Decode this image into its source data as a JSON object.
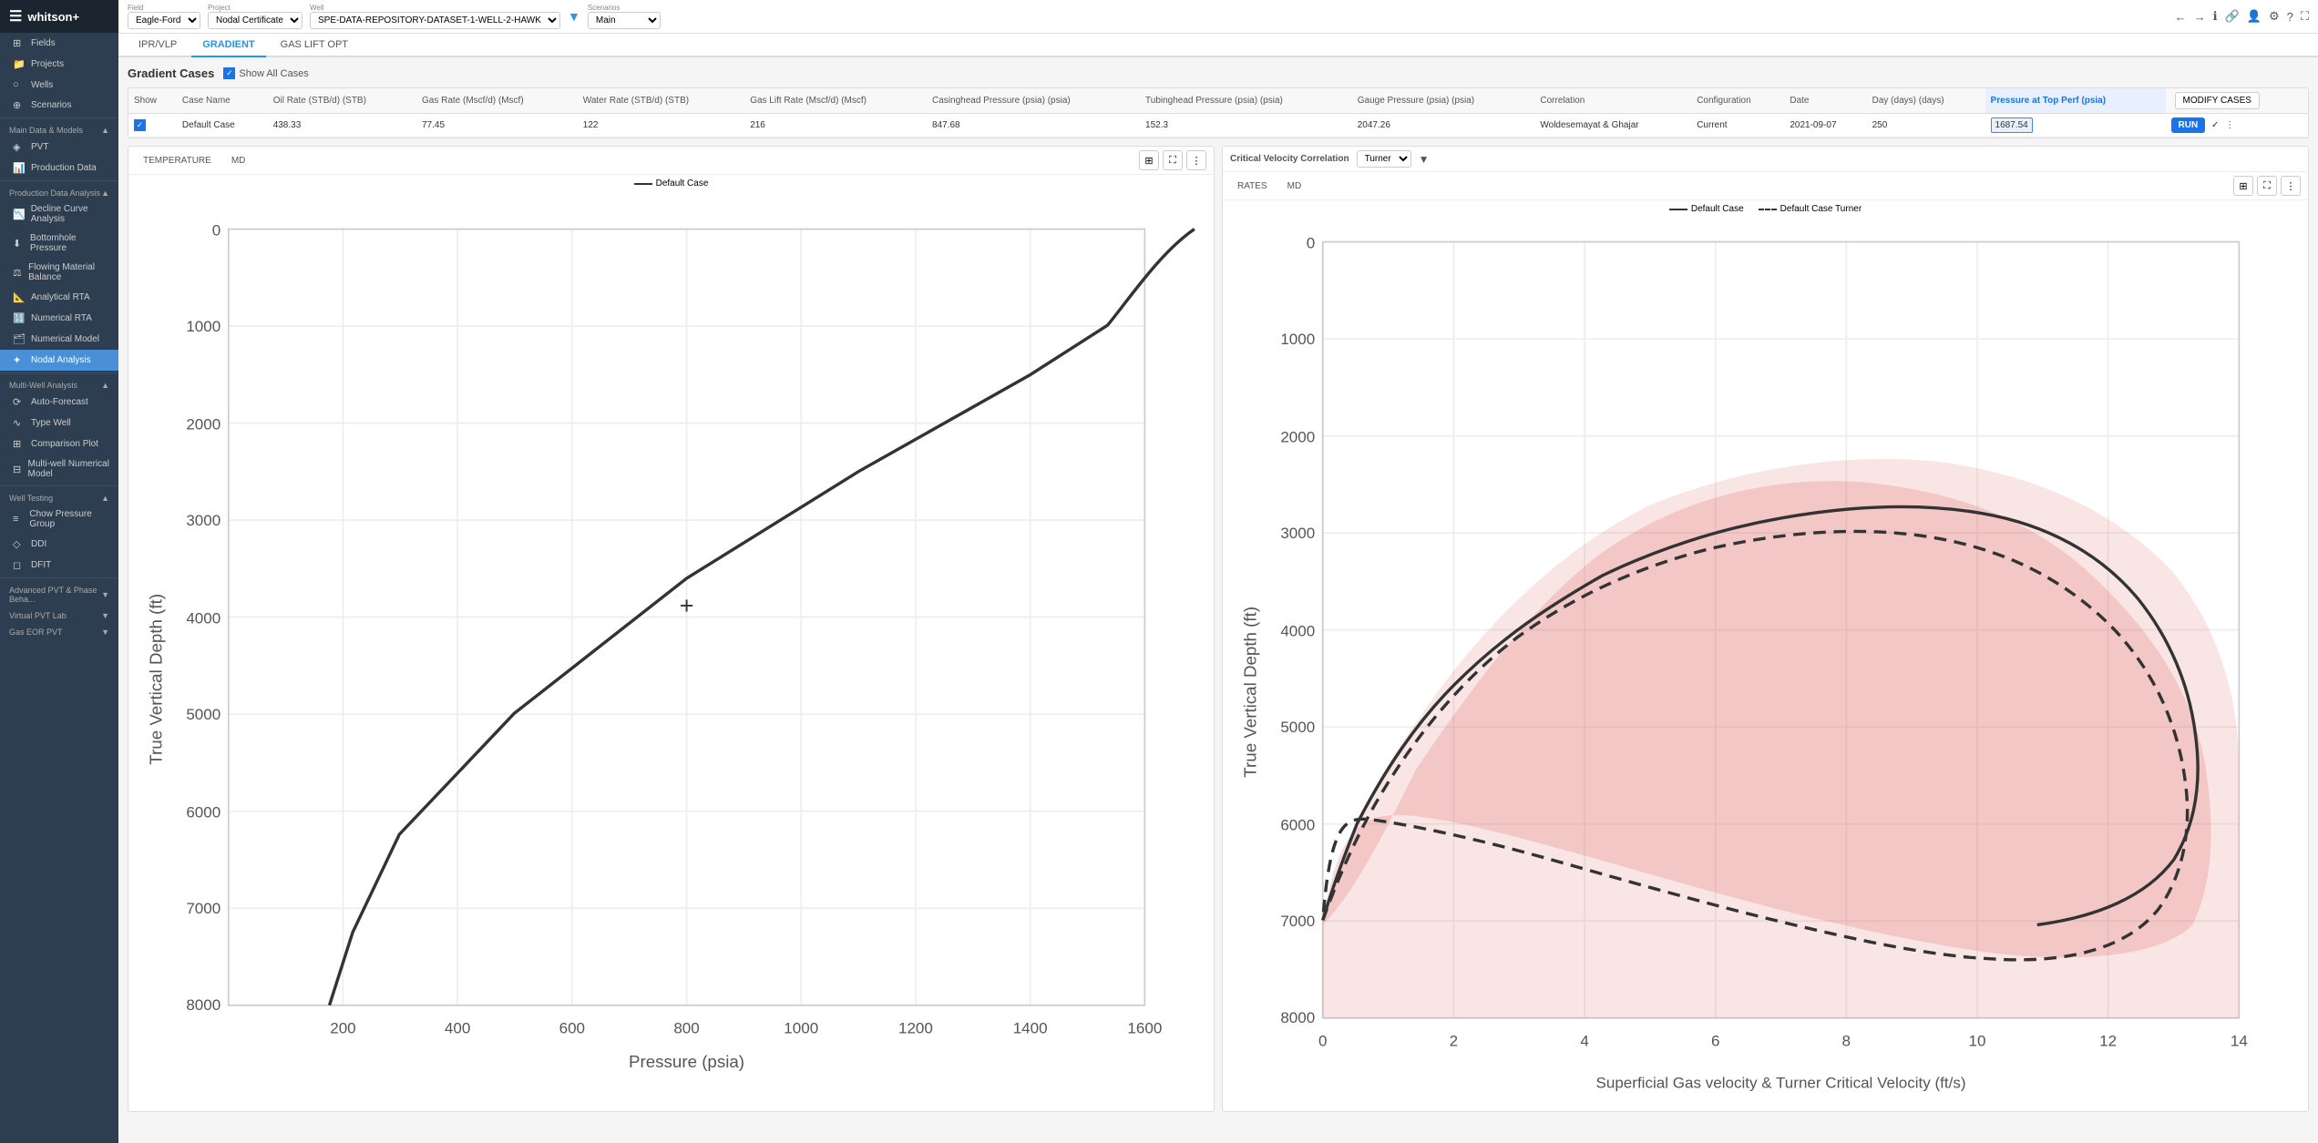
{
  "app": {
    "title": "whitson+",
    "hamburger": "☰"
  },
  "topbar": {
    "field_label": "Field",
    "field_value": "Eagle-Ford",
    "project_label": "Project",
    "project_value": "Nodal Certificate",
    "well_label": "Well",
    "well_value": "SPE-DATA-REPOSITORY-DATASET-1-WELL-2-HAWK",
    "scenarios_label": "Scenarios",
    "scenarios_value": "Main"
  },
  "sidebar": {
    "sections": [
      {
        "name": "Main Data & Models",
        "items": [
          {
            "label": "PVT",
            "icon": "◈"
          },
          {
            "label": "Production Data",
            "icon": "📊"
          }
        ]
      },
      {
        "name": "Production Data Analysis",
        "items": [
          {
            "label": "Decline Curve Analysis",
            "icon": "📉"
          },
          {
            "label": "Bottomhole Pressure",
            "icon": "⬇"
          },
          {
            "label": "Flowing Material Balance",
            "icon": "⚖"
          },
          {
            "label": "Analytical RTA",
            "icon": "📐"
          },
          {
            "label": "Numerical RTA",
            "icon": "🔢"
          },
          {
            "label": "Numerical Model",
            "icon": "🗂"
          },
          {
            "label": "Nodal Analysis",
            "icon": "✦",
            "active": true
          }
        ]
      },
      {
        "name": "Multi-Well Analysis",
        "items": [
          {
            "label": "Auto-Forecast",
            "icon": "⟳"
          },
          {
            "label": "Type Well",
            "icon": "∿"
          },
          {
            "label": "Comparison Plot",
            "icon": "⊞"
          },
          {
            "label": "Multi-well Numerical Model",
            "icon": "⊟"
          }
        ]
      },
      {
        "name": "Well Testing",
        "items": [
          {
            "label": "Chow Pressure Group",
            "icon": "≡"
          },
          {
            "label": "DDI",
            "icon": "◇"
          },
          {
            "label": "DFIT",
            "icon": "◻"
          }
        ]
      },
      {
        "name": "Advanced PVT & Phase Beha...",
        "items": []
      },
      {
        "name": "Virtual PVT Lab",
        "items": []
      },
      {
        "name": "Gas EOR PVT",
        "items": []
      }
    ],
    "top_items": [
      {
        "label": "Fields",
        "icon": "⊞"
      },
      {
        "label": "Projects",
        "icon": "📁"
      },
      {
        "label": "Wells",
        "icon": "○"
      },
      {
        "label": "Scenarios",
        "icon": "⊕"
      }
    ]
  },
  "nav_tabs": [
    {
      "label": "IPR/VLP",
      "active": false
    },
    {
      "label": "GRADIENT",
      "active": true
    },
    {
      "label": "GAS LIFT OPT",
      "active": false
    }
  ],
  "gradient_cases": {
    "title": "Gradient Cases",
    "show_all_label": "Show All Cases",
    "show_all_checked": true,
    "modify_cases_label": "MODIFY CASES",
    "table_headers": [
      "Show",
      "Case Name",
      "Oil Rate (STB/d) (STB)",
      "Gas Rate (Mscf/d) (Mscf)",
      "Water Rate (STB/d) (STB)",
      "Gas Lift Rate (Mscf/d) (Mscf)",
      "Casinghead Pressure (psia) (psia)",
      "Tubinghead Pressure (psia) (psia)",
      "Gauge Pressure (psia) (psia)",
      "Correlation",
      "Configuration",
      "Date",
      "Day (days) (days)",
      "Pressure at Top Perf (psia)",
      ""
    ],
    "rows": [
      {
        "show": true,
        "case_name": "Default Case",
        "oil_rate": "438.33",
        "gas_rate": "77.45",
        "water_rate": "122",
        "gas_lift_rate": "216",
        "casinghead_pressure": "847.68",
        "tubinghead_pressure": "152.3",
        "gauge_pressure": "2047.26",
        "correlation": "Woldesemayat & Ghajar",
        "configuration": "Current",
        "date": "2021-09-07",
        "days": "250",
        "pressure_top_perf": "1687.54",
        "run_label": "RUN"
      }
    ]
  },
  "left_chart": {
    "toolbar_tabs": [
      {
        "label": "TEMPERATURE",
        "active": false
      },
      {
        "label": "MD",
        "active": false
      }
    ],
    "legend": [
      {
        "label": "Default Case",
        "style": "solid",
        "color": "#333"
      }
    ],
    "y_axis_label": "True Vertical Depth (ft)",
    "x_axis_label": "Pressure (psia)",
    "y_ticks": [
      0,
      1000,
      2000,
      3000,
      4000,
      5000,
      6000,
      7000,
      8000
    ],
    "x_ticks": [
      200,
      400,
      600,
      800,
      1000,
      1200,
      1400,
      1600
    ]
  },
  "right_chart": {
    "correlation_label": "Critical Velocity Correlation",
    "correlation_value": "Turner",
    "toolbar_tabs": [
      {
        "label": "RATES",
        "active": false
      },
      {
        "label": "MD",
        "active": false
      }
    ],
    "legend": [
      {
        "label": "Default Case",
        "style": "solid",
        "color": "#333"
      },
      {
        "label": "Default Case Turner",
        "style": "dashed",
        "color": "#333"
      }
    ],
    "y_axis_label": "True Vertical Depth (ft)",
    "x_axis_label": "Superficial Gas velocity & Turner Critical Velocity (ft/s)",
    "y_ticks": [
      0,
      1000,
      2000,
      3000,
      4000,
      5000,
      6000,
      7000,
      8000
    ],
    "x_ticks": [
      0,
      2,
      4,
      6,
      8,
      10,
      12,
      14
    ]
  }
}
